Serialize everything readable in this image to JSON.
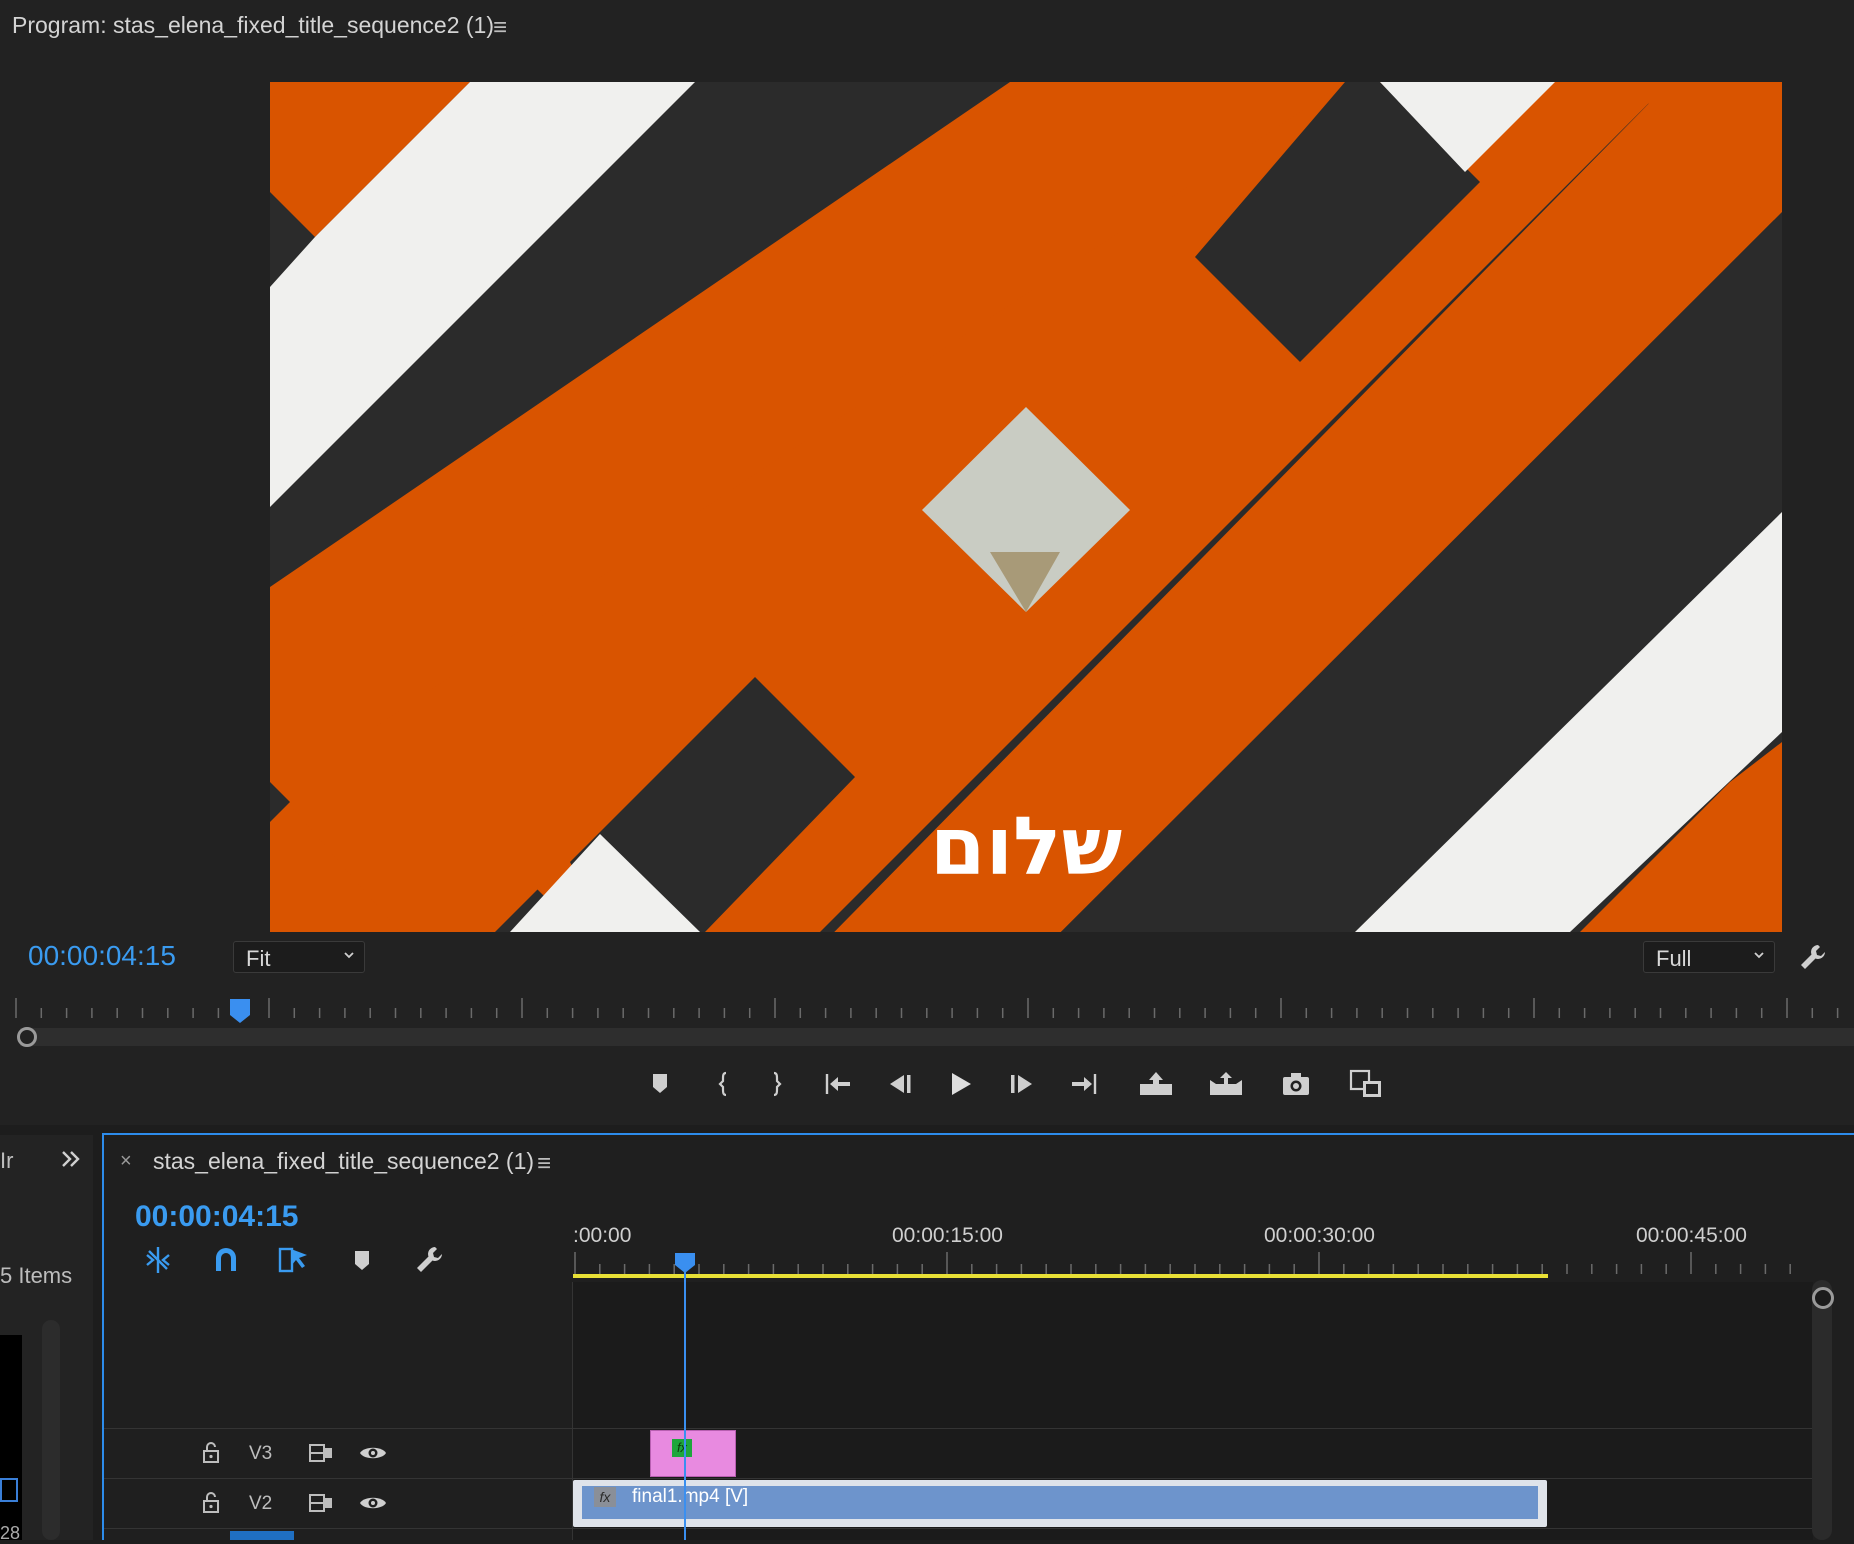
{
  "program_monitor": {
    "title": "Program: stas_elena_fixed_title_sequence2 (1)",
    "menu_icon": "hamburger-icon",
    "overlay_text": "שלום",
    "timecode": "00:00:04:15",
    "zoom": "Fit",
    "resolution": "Full",
    "transport": [
      {
        "name": "add-marker-button",
        "icon": "marker-icon"
      },
      {
        "name": "mark-in-button",
        "icon": "mark-in-icon"
      },
      {
        "name": "mark-out-button",
        "icon": "mark-out-icon"
      },
      {
        "name": "go-to-in-button",
        "icon": "go-to-in-icon"
      },
      {
        "name": "step-back-button",
        "icon": "step-back-icon"
      },
      {
        "name": "play-button",
        "icon": "play-icon"
      },
      {
        "name": "step-forward-button",
        "icon": "step-forward-icon"
      },
      {
        "name": "go-to-out-button",
        "icon": "go-to-out-icon"
      },
      {
        "name": "lift-button",
        "icon": "lift-icon"
      },
      {
        "name": "extract-button",
        "icon": "extract-icon"
      },
      {
        "name": "export-frame-button",
        "icon": "camera-icon"
      },
      {
        "name": "comparison-view-button",
        "icon": "comparison-view-icon"
      }
    ],
    "playhead_fraction": 0.095
  },
  "left_panel": {
    "tab_fragment": "Ir",
    "expand_icon": "double-chevron-right-icon",
    "items_count": "5 Items",
    "bottom_text": "28"
  },
  "timeline": {
    "close_label": "×",
    "title": "stas_elena_fixed_title_sequence2 (1)",
    "timecode": "00:00:04:15",
    "ruler_labels": [
      ":00:00",
      "00:00:15:00",
      "00:00:30:00",
      "00:00:45:00"
    ],
    "tools": [
      "ripple-snap-icon",
      "magnet-snap-icon",
      "linked-selection-icon",
      "marker-icon",
      "wrench-icon"
    ],
    "tracks": [
      {
        "label": "V3",
        "lock_icon": "lock-icon",
        "sync_icon": "track-sync-icon",
        "eye_icon": "eye-icon"
      },
      {
        "label": "V2",
        "lock_icon": "lock-icon",
        "sync_icon": "track-sync-icon",
        "eye_icon": "eye-icon"
      }
    ],
    "clips": {
      "v3": {
        "label": "fx",
        "color": "#e88ae0"
      },
      "v2": {
        "label": "final1.mp4 [V]",
        "fx": "fx",
        "color": "#6d94cc"
      }
    }
  },
  "colors": {
    "accent": "#3a9bf0",
    "orange": "#d95400",
    "workarea": "#e8e036"
  }
}
